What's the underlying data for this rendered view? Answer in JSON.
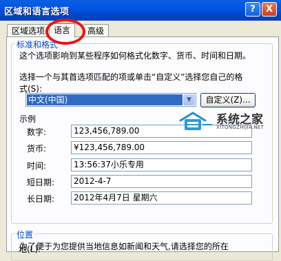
{
  "window": {
    "title": "区域和语言选项",
    "help_btn": "?",
    "close_btn": "X"
  },
  "tabs": [
    {
      "label": "区域选项",
      "active": false
    },
    {
      "label": "语言",
      "active": true
    },
    {
      "label": "高级",
      "active": false
    }
  ],
  "standards_group": {
    "legend": "标准和格式",
    "description": "这个选项影响到某些程序如何格式化数字、货币、时间和日期。",
    "instruction_line1": "选择一个与其首选项匹配的项或单击“自定义”选择您自己的格",
    "instruction_line2": "式(S):",
    "selected_locale": "中文(中国)",
    "customize_button": "自定义(Z)...",
    "samples_label": "示例",
    "samples": [
      {
        "label": "数字:",
        "value": "123,456,789.00"
      },
      {
        "label": "货币:",
        "value": "¥123,456,789.00"
      },
      {
        "label": "时间:",
        "value": "13:56:37小乐专用"
      },
      {
        "label": "短日期:",
        "value": "2012-4-7"
      },
      {
        "label": "长日期:",
        "value": "2012年4月7日 星期六"
      }
    ]
  },
  "location_group": {
    "legend": "位置",
    "description_line1": "为了便于为您提供当地信息如新闻和天气,请选择您的所在",
    "description_line2": "地(L):"
  },
  "watermark": {
    "title": "系统之家",
    "url": "XITONGZHIJIA.NET"
  },
  "colors": {
    "titlebar": "#0055E5",
    "group_legend": "#0046D5",
    "selection": "#316AC5",
    "annotation_circle": "#E11111"
  }
}
